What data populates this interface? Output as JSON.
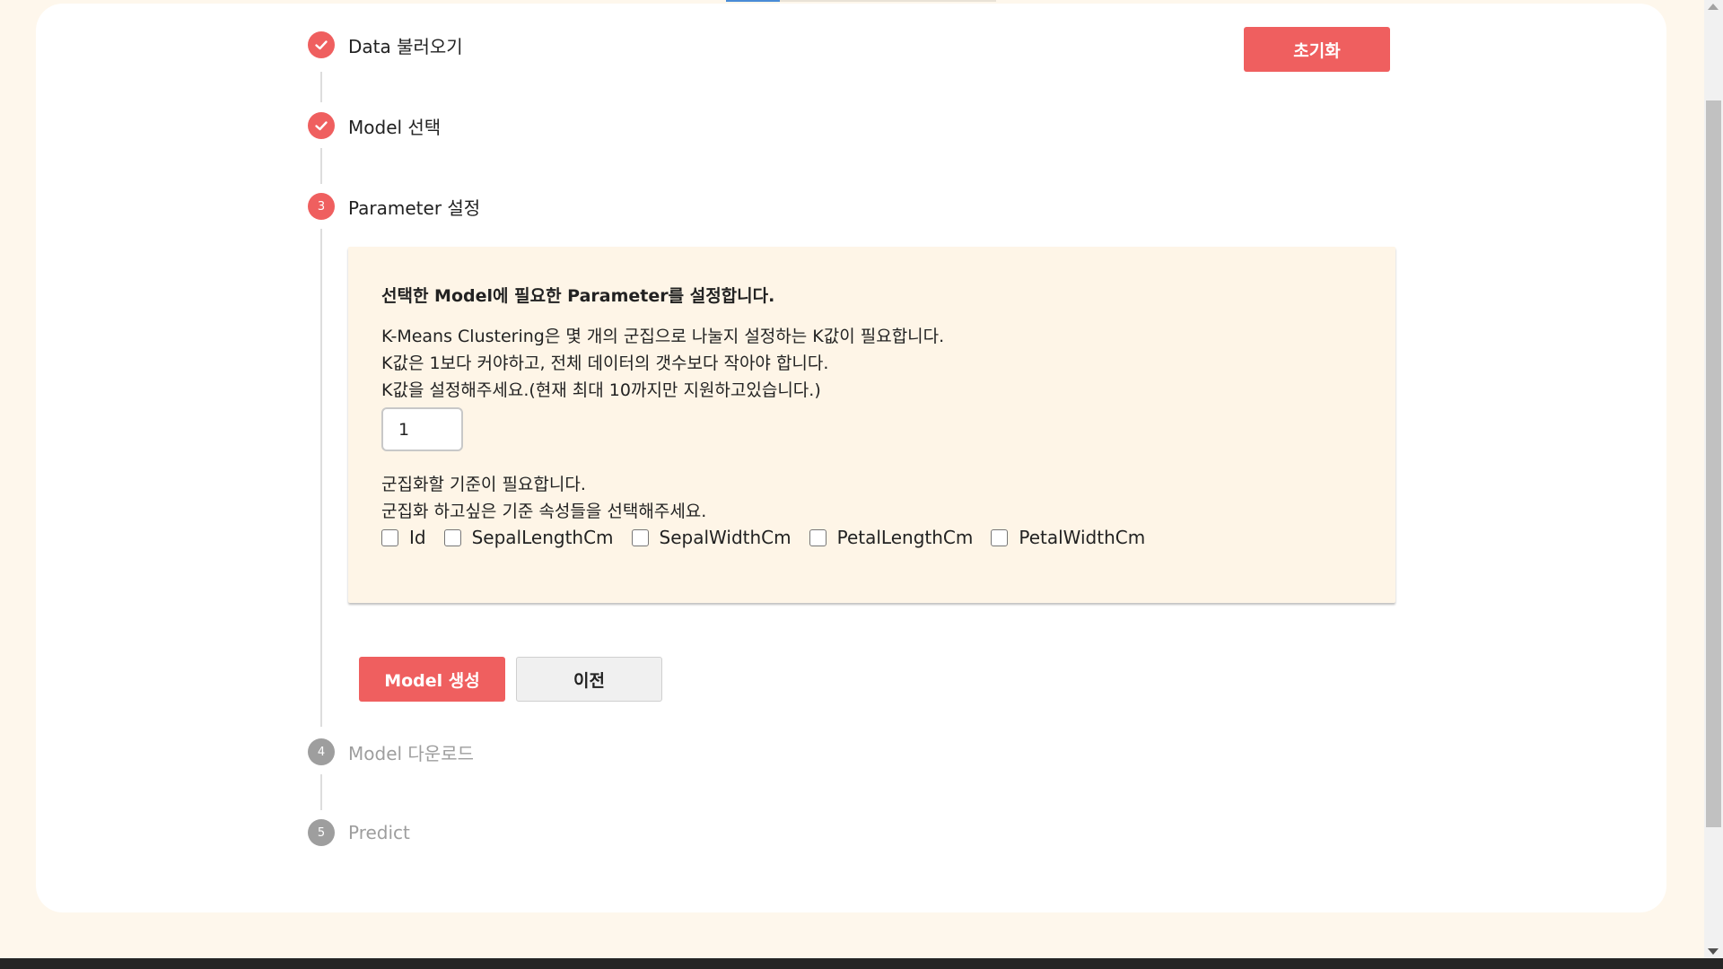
{
  "header": {
    "reset_label": "초기화"
  },
  "steps": [
    {
      "number": "",
      "label": "Data 불러오기",
      "status": "done",
      "icon": "check-icon"
    },
    {
      "number": "",
      "label": "Model 선택",
      "status": "done",
      "icon": "check-icon"
    },
    {
      "number": "3",
      "label": "Parameter 설정",
      "status": "active"
    },
    {
      "number": "4",
      "label": "Model 다운로드",
      "status": "pending"
    },
    {
      "number": "5",
      "label": "Predict",
      "status": "pending"
    }
  ],
  "panel": {
    "heading": "선택한 Model에 필요한 Parameter를 설정합니다.",
    "k_desc_1": "K-Means Clustering은 몇 개의 군집으로 나눌지 설정하는 K값이 필요합니다.",
    "k_desc_2": "K값은 1보다 커야하고, 전체 데이터의 갯수보다 작아야 합니다.",
    "k_desc_3": "K값을 설정해주세요.(현재 최대 10까지만 지원하고있습니다.)",
    "k_value": "1",
    "criteria_desc_1": "군집화할 기준이 필요합니다.",
    "criteria_desc_2": "군집화 하고싶은 기준 속성들을 선택해주세요.",
    "attributes": [
      {
        "label": "Id",
        "checked": false
      },
      {
        "label": "SepalLengthCm",
        "checked": false
      },
      {
        "label": "SepalWidthCm",
        "checked": false
      },
      {
        "label": "PetalLengthCm",
        "checked": false
      },
      {
        "label": "PetalWidthCm",
        "checked": false
      }
    ]
  },
  "actions": {
    "create_label": "Model 생성",
    "prev_label": "이전"
  },
  "colors": {
    "accent": "#ef5f5f",
    "pending": "#9e9e9e",
    "page_bg": "#fef7ec",
    "panel_bg": "#fef5e7"
  }
}
